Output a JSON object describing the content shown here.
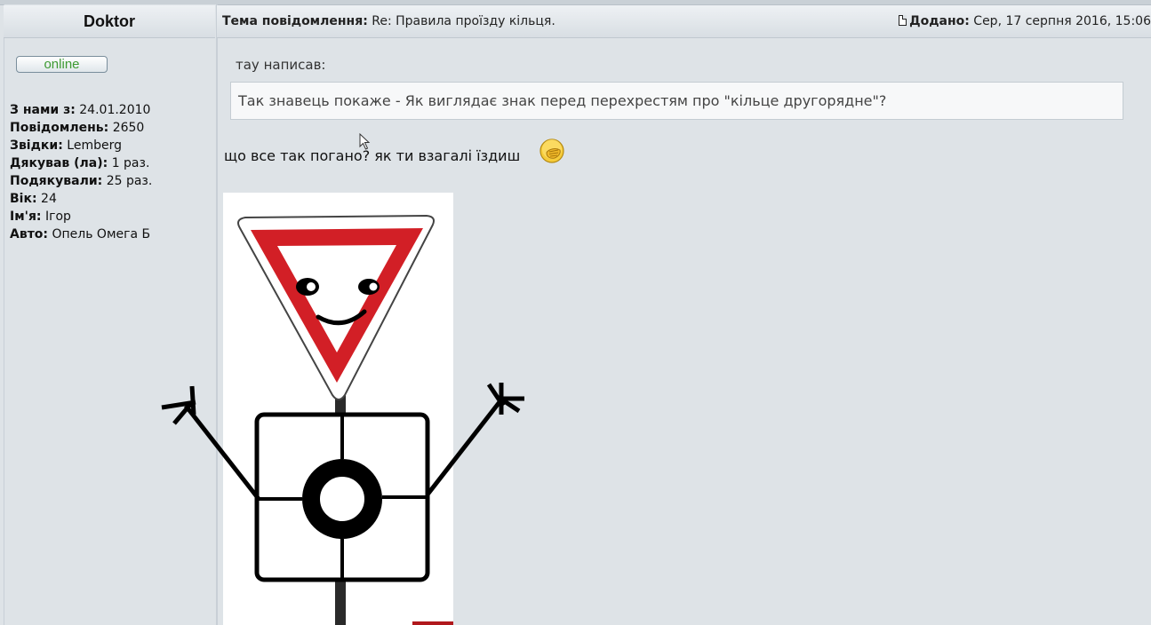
{
  "author": {
    "name": "Doktor",
    "status": "online",
    "profile": [
      {
        "label": "З нами з:",
        "value": "24.01.2010"
      },
      {
        "label": "Повідомлень:",
        "value": "2650"
      },
      {
        "label": "Звідки:",
        "value": "Lemberg"
      },
      {
        "label": "Дякував (ла):",
        "value": "1 раз."
      },
      {
        "label": "Подякували:",
        "value": "25 раз."
      },
      {
        "label": "Вік:",
        "value": "24"
      },
      {
        "label": "Ім'я:",
        "value": "Ігор"
      },
      {
        "label": "Авто:",
        "value": "Опель Омега Б"
      }
    ]
  },
  "header": {
    "subject_label": "Тема повідомлення:",
    "subject": "Re: Правила проїзду кільця.",
    "added_label": "Додано:",
    "added_value": "Сер, 17 серпня 2016, 15:06"
  },
  "post": {
    "quote_author": "тау написав:",
    "quote_text": "Так знавець покаже - Як виглядає знак перед перехрестям про \"кільце другорядне\"?",
    "reply_text": "що все так погано? як ти взагалі їздиш"
  },
  "icons": {
    "post": "post-icon",
    "emoji": "facepalm-emoji-icon",
    "cursor": "mouse-cursor-icon"
  },
  "colors": {
    "online_text": "#3d9a32",
    "sign_red": "#d21f26",
    "background": "#dee3e7"
  }
}
